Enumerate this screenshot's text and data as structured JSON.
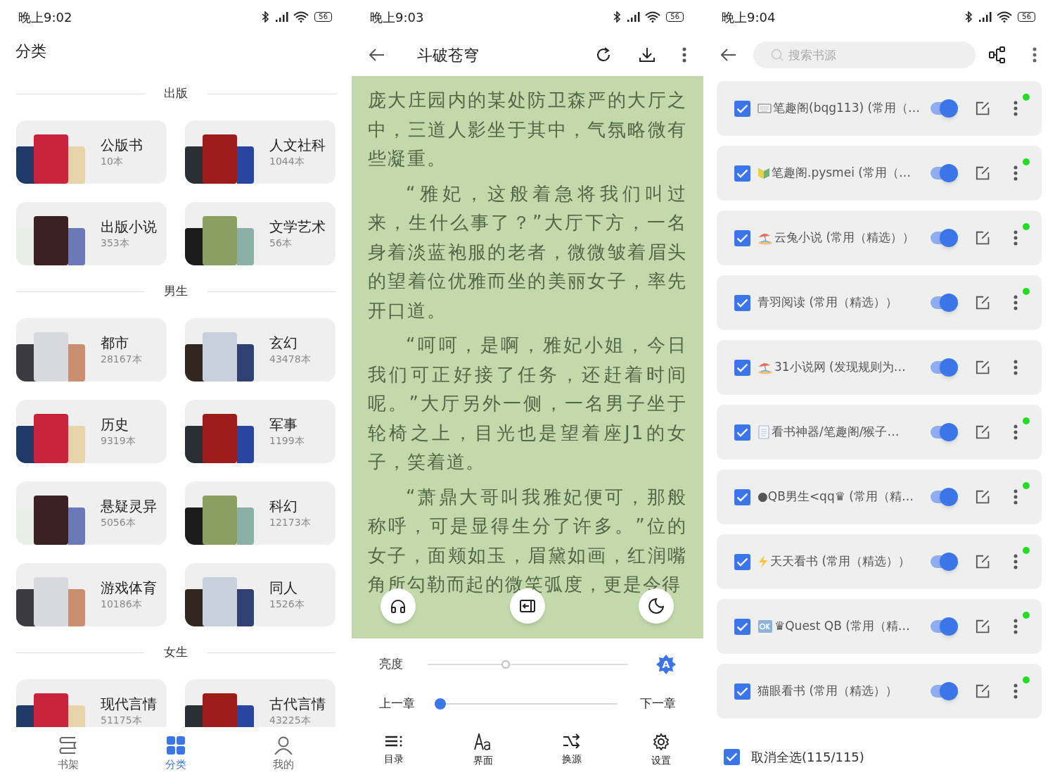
{
  "category_screen": {
    "status_bar": {
      "time": "晚上9:02",
      "battery": "56"
    },
    "title": "分类",
    "sections": [
      {
        "label": "出版",
        "cards": [
          {
            "name": "公版书",
            "count": "10本"
          },
          {
            "name": "人文社科",
            "count": "1044本"
          },
          {
            "name": "出版小说",
            "count": "353本"
          },
          {
            "name": "文学艺术",
            "count": "56本"
          }
        ]
      },
      {
        "label": "男生",
        "cards": [
          {
            "name": "都市",
            "count": "28167本"
          },
          {
            "name": "玄幻",
            "count": "43478本"
          },
          {
            "name": "历史",
            "count": "9319本"
          },
          {
            "name": "军事",
            "count": "1199本"
          },
          {
            "name": "悬疑灵异",
            "count": "5056本"
          },
          {
            "name": "科幻",
            "count": "12173本"
          },
          {
            "name": "游戏体育",
            "count": "10186本"
          },
          {
            "name": "同人",
            "count": "1526本"
          }
        ]
      },
      {
        "label": "女生",
        "cards": [
          {
            "name": "现代言情",
            "count": "51175本"
          },
          {
            "name": "古代言情",
            "count": "43225本"
          }
        ]
      }
    ],
    "bottom_nav": [
      {
        "kind": "shelf",
        "label": "书架",
        "selected": false
      },
      {
        "kind": "grid",
        "label": "分类",
        "selected": true
      },
      {
        "kind": "person",
        "label": "我的",
        "selected": false
      }
    ]
  },
  "reader_screen": {
    "status_bar": {
      "time": "晚上9:03",
      "battery": "56"
    },
    "title": "斗破苍穹",
    "paragraphs": [
      {
        "text": "庞大庄园内的某处防卫森严的大厅之中，三道人影坐于其中，气氛略微有些凝重。",
        "indent": false
      },
      {
        "text": "“雅妃，这般着急将我们叫过来，生什么事了？”大厅下方，一名身着淡蓝袍服的老者，微微皱着眉头的望着位优雅而坐的美丽女子，率先开口道。",
        "indent": true
      },
      {
        "text": "“呵呵，是啊，雅妃小姐，今日我们可正好接了任务，还赶着时间呢。”大厅另外一侧，一名男子坐于轮椅之上，目光也是望着座J1的女子，笑着道。",
        "indent": true
      },
      {
        "text": "“萧鼎大哥叫我雅妃便可，那般称呼，可是显得生分了许多。”位的女子，面颊如玉，眉黛如画，红润嘴角所勾勒而起的微笑弧度，更是令得",
        "indent": true
      }
    ],
    "brightness": {
      "label": "亮度",
      "level": 0.39,
      "auto_label": "A"
    },
    "chapter": {
      "prev": "上一章",
      "next": "下一章",
      "level": 0
    },
    "actions": [
      {
        "kind": "toc",
        "label": "目录"
      },
      {
        "kind": "font",
        "label": "界面"
      },
      {
        "kind": "swap",
        "label": "换源"
      },
      {
        "kind": "settings",
        "label": "设置"
      }
    ]
  },
  "source_screen": {
    "status_bar": {
      "time": "晚上9:04",
      "battery": "56"
    },
    "search": {
      "placeholder": "搜索书源"
    },
    "items": [
      {
        "kind": "keyboard",
        "name": "笔趣阁(bqg113) (常用（…",
        "checked": true,
        "enabled": true,
        "online": true
      },
      {
        "kind": "badge",
        "name": "笔趣阁.pysmei (常用（…",
        "checked": true,
        "enabled": true,
        "online": true
      },
      {
        "kind": "umbrella",
        "name": "云兔小说 (常用（精选））",
        "checked": true,
        "enabled": true,
        "online": true
      },
      {
        "kind": "plain",
        "name": "青羽阅读 (常用（精选））",
        "checked": true,
        "enabled": true,
        "online": true
      },
      {
        "kind": "umbrella",
        "name": "31小说网 (发现规则为…",
        "checked": true,
        "enabled": true,
        "online": false
      },
      {
        "kind": "page",
        "name": "看书神器/笔趣阁/猴子…",
        "checked": true,
        "enabled": true,
        "online": true
      },
      {
        "kind": "plain",
        "name": "●QB男生<qq♛ (常用（精…",
        "checked": true,
        "enabled": true,
        "online": true
      },
      {
        "kind": "bolt",
        "name": "天天看书 (常用（精选））",
        "checked": true,
        "enabled": true,
        "online": true
      },
      {
        "kind": "ok",
        "name": "♛Quest QB (常用（精…",
        "checked": true,
        "enabled": true,
        "online": true
      },
      {
        "kind": "plain",
        "name": "猫眼看书 (常用（精选））",
        "checked": true,
        "enabled": true,
        "online": true
      }
    ],
    "select_all": {
      "label": "取消全选(115/115)",
      "checked": true
    }
  }
}
